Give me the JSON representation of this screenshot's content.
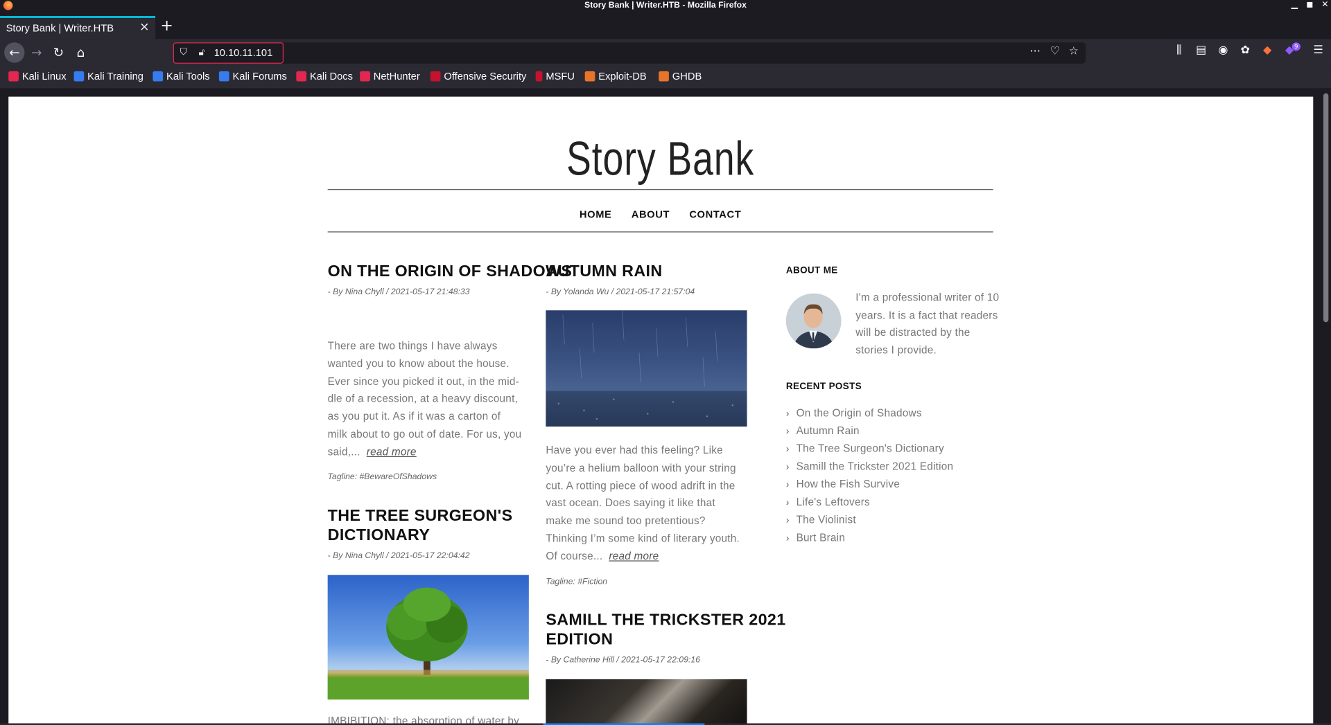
{
  "browser": {
    "window_title": "Story Bank | Writer.HTB - Mozilla Firefox",
    "tab_title": "Story Bank | Writer.HTB",
    "url": "10.10.11.101",
    "extension_badge": "9",
    "bookmarks": [
      "Kali Linux",
      "Kali Training",
      "Kali Tools",
      "Kali Forums",
      "Kali Docs",
      "NetHunter",
      "Offensive Security",
      "MSFU",
      "Exploit-DB",
      "GHDB"
    ]
  },
  "site": {
    "title": "Story Bank",
    "nav": [
      "HOME",
      "ABOUT",
      "CONTACT"
    ]
  },
  "posts": [
    {
      "title": "ON THE ORIGIN OF SHADOWS",
      "meta": "- By Nina Chyll / 2021-05-17 21:48:33",
      "excerpt_lines": [
        "There are two things I have always",
        "wanted you to know about the house.",
        "Ever since you picked it out, in the mid-",
        "dle of a recession, at a heavy discount,",
        "as you put it. As if it was a carton of",
        "milk about to go out of date. For us, you",
        "said,..."
      ],
      "read_more": "read more",
      "tagline": "Tagline: #BewareOfShadows"
    },
    {
      "title": "AUTUMN RAIN",
      "meta": "- By Yolanda Wu / 2021-05-17 21:57:04",
      "excerpt_lines": [
        "Have you ever had this feeling? Like",
        "you’re a helium balloon with your string",
        "cut. A rotting piece of wood adrift in the",
        "vast ocean. Does saying it like that",
        "make me sound too pretentious?",
        "Thinking I’m some kind of literary youth.",
        "Of course..."
      ],
      "read_more": "read more",
      "tagline": "Tagline: #Fiction"
    },
    {
      "title_lines": [
        "THE TREE SURGEON'S",
        "DICTIONARY"
      ],
      "meta": "- By Nina Chyll / 2021-05-17 22:04:42",
      "excerpt_start": "IMBIBITION: the absorption of water by"
    },
    {
      "title_lines": [
        "SAMILL THE TRICKSTER 2021",
        "EDITION"
      ],
      "meta": "- By Catherine Hill / 2021-05-17 22:09:16"
    }
  ],
  "sidebar": {
    "about_heading": "ABOUT ME",
    "about_text": "I'm a professional writer of 10 years. It is a fact that readers will be distracted by the stories I provide.",
    "recent_heading": "RECENT POSTS",
    "recent_posts": [
      "On the Origin of Shadows",
      "Autumn Rain",
      "The Tree Surgeon's Dictionary",
      "Samill the Trickster 2021 Edition",
      "How the Fish Survive",
      "Life's Leftovers",
      "The Violinist",
      "Burt Brain"
    ]
  }
}
